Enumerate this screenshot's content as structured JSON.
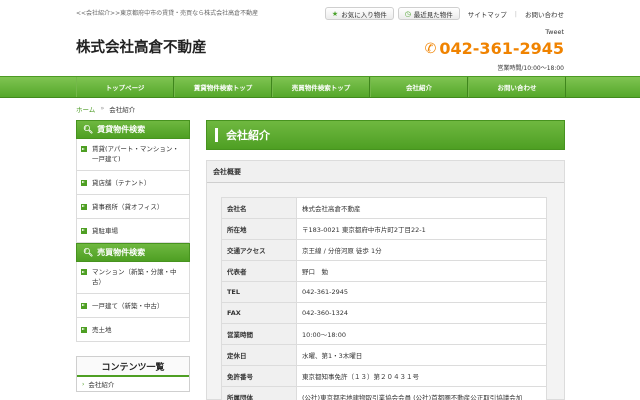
{
  "header": {
    "tagline": "<<会社紹介>>東京都府中市の賃貸・売買なら株式会社高倉不動産",
    "favorites_label": "お気に入り物件",
    "recent_label": "最近見た物件",
    "sitemap_label": "サイトマップ",
    "contact_label": "お問い合わせ",
    "site_title": "株式会社高倉不動産",
    "tweet_label": "Tweet",
    "phone": "042-361-2945",
    "hours": "営業時間/10:00～18:00"
  },
  "nav": {
    "items": [
      "トップページ",
      "賃貸物件検索トップ",
      "売買物件検索トップ",
      "会社紹介",
      "お問い合わせ"
    ]
  },
  "breadcrumb": {
    "home": "ホーム",
    "separator": "»",
    "current": "会社紹介"
  },
  "sidebar": {
    "rent_head": "賃貸物件検索",
    "rent_items": [
      "賃貸(アパート・マンション・一戸建て)",
      "貸店舗（テナント）",
      "貸事務所（貸オフィス）",
      "貸駐車場"
    ],
    "sale_head": "売買物件検索",
    "sale_items": [
      "マンション（新築・分譲・中古）",
      "一戸建て（新築・中古）",
      "売土地"
    ],
    "contents_head": "コンテンツ一覧",
    "contents_items": [
      "会社紹介"
    ]
  },
  "main": {
    "page_title": "会社紹介",
    "panel_title": "会社概要",
    "rows": [
      {
        "label": "会社名",
        "value": "株式会社高倉不動産"
      },
      {
        "label": "所在地",
        "value": "〒183-0021 東京都府中市片町2丁目22-1"
      },
      {
        "label": "交通アクセス",
        "value": "京王線 / 分倍河原 徒歩 1分"
      },
      {
        "label": "代表者",
        "value": "野口　勉"
      },
      {
        "label": "TEL",
        "value": "042-361-2945"
      },
      {
        "label": "FAX",
        "value": "042-360-1324"
      },
      {
        "label": "営業時間",
        "value": "10:00～18:00"
      },
      {
        "label": "定休日",
        "value": "水曜、第1・3木曜日"
      },
      {
        "label": "免許番号",
        "value": "東京都知事免許（１３）第２０４３１号"
      },
      {
        "label": "所属団体",
        "value": "(公社)東京都宅地建物取引業協会会員 (公社)首都圏不動産公正取引協議会加"
      }
    ]
  },
  "colors": {
    "accent_green": "#4e9f23",
    "phone_orange": "#f08300"
  },
  "icons": {
    "favorites": "star-icon",
    "recent": "clock-icon",
    "phone": "phone-icon",
    "search": "search-icon"
  }
}
